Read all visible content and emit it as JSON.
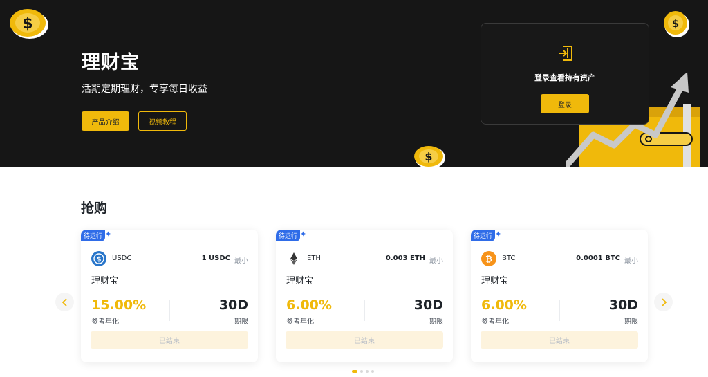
{
  "hero": {
    "title": "理财宝",
    "subtitle": "活期定期理财，专享每日收益",
    "intro_button": "产品介绍",
    "video_button": "视频教程"
  },
  "login_card": {
    "text": "登录查看持有资产",
    "button": "登录"
  },
  "section": {
    "title": "抢购"
  },
  "products": [
    {
      "badge": "待运行",
      "coin": "USDC",
      "coin_icon": "usdc-icon",
      "min_amount": "1 USDC",
      "min_label": "最小",
      "name": "理财宝",
      "apr": "15.00%",
      "apr_label": "参考年化",
      "term": "30D",
      "term_label": "期限",
      "action": "已结束"
    },
    {
      "badge": "待运行",
      "coin": "ETH",
      "coin_icon": "eth-icon",
      "min_amount": "0.003 ETH",
      "min_label": "最小",
      "name": "理财宝",
      "apr": "6.00%",
      "apr_label": "参考年化",
      "term": "30D",
      "term_label": "期限",
      "action": "已结束"
    },
    {
      "badge": "待运行",
      "coin": "BTC",
      "coin_icon": "btc-icon",
      "min_amount": "0.0001 BTC",
      "min_label": "最小",
      "name": "理财宝",
      "apr": "6.00%",
      "apr_label": "参考年化",
      "term": "30D",
      "term_label": "期限",
      "action": "已结束"
    }
  ],
  "carousel": {
    "page_count": 4,
    "active_page": 1
  },
  "colors": {
    "accent": "#f0b90b",
    "hero_bg": "#161616",
    "badge": "#2f6ce8",
    "usdc": "#2775ca",
    "btc": "#f7931a"
  }
}
